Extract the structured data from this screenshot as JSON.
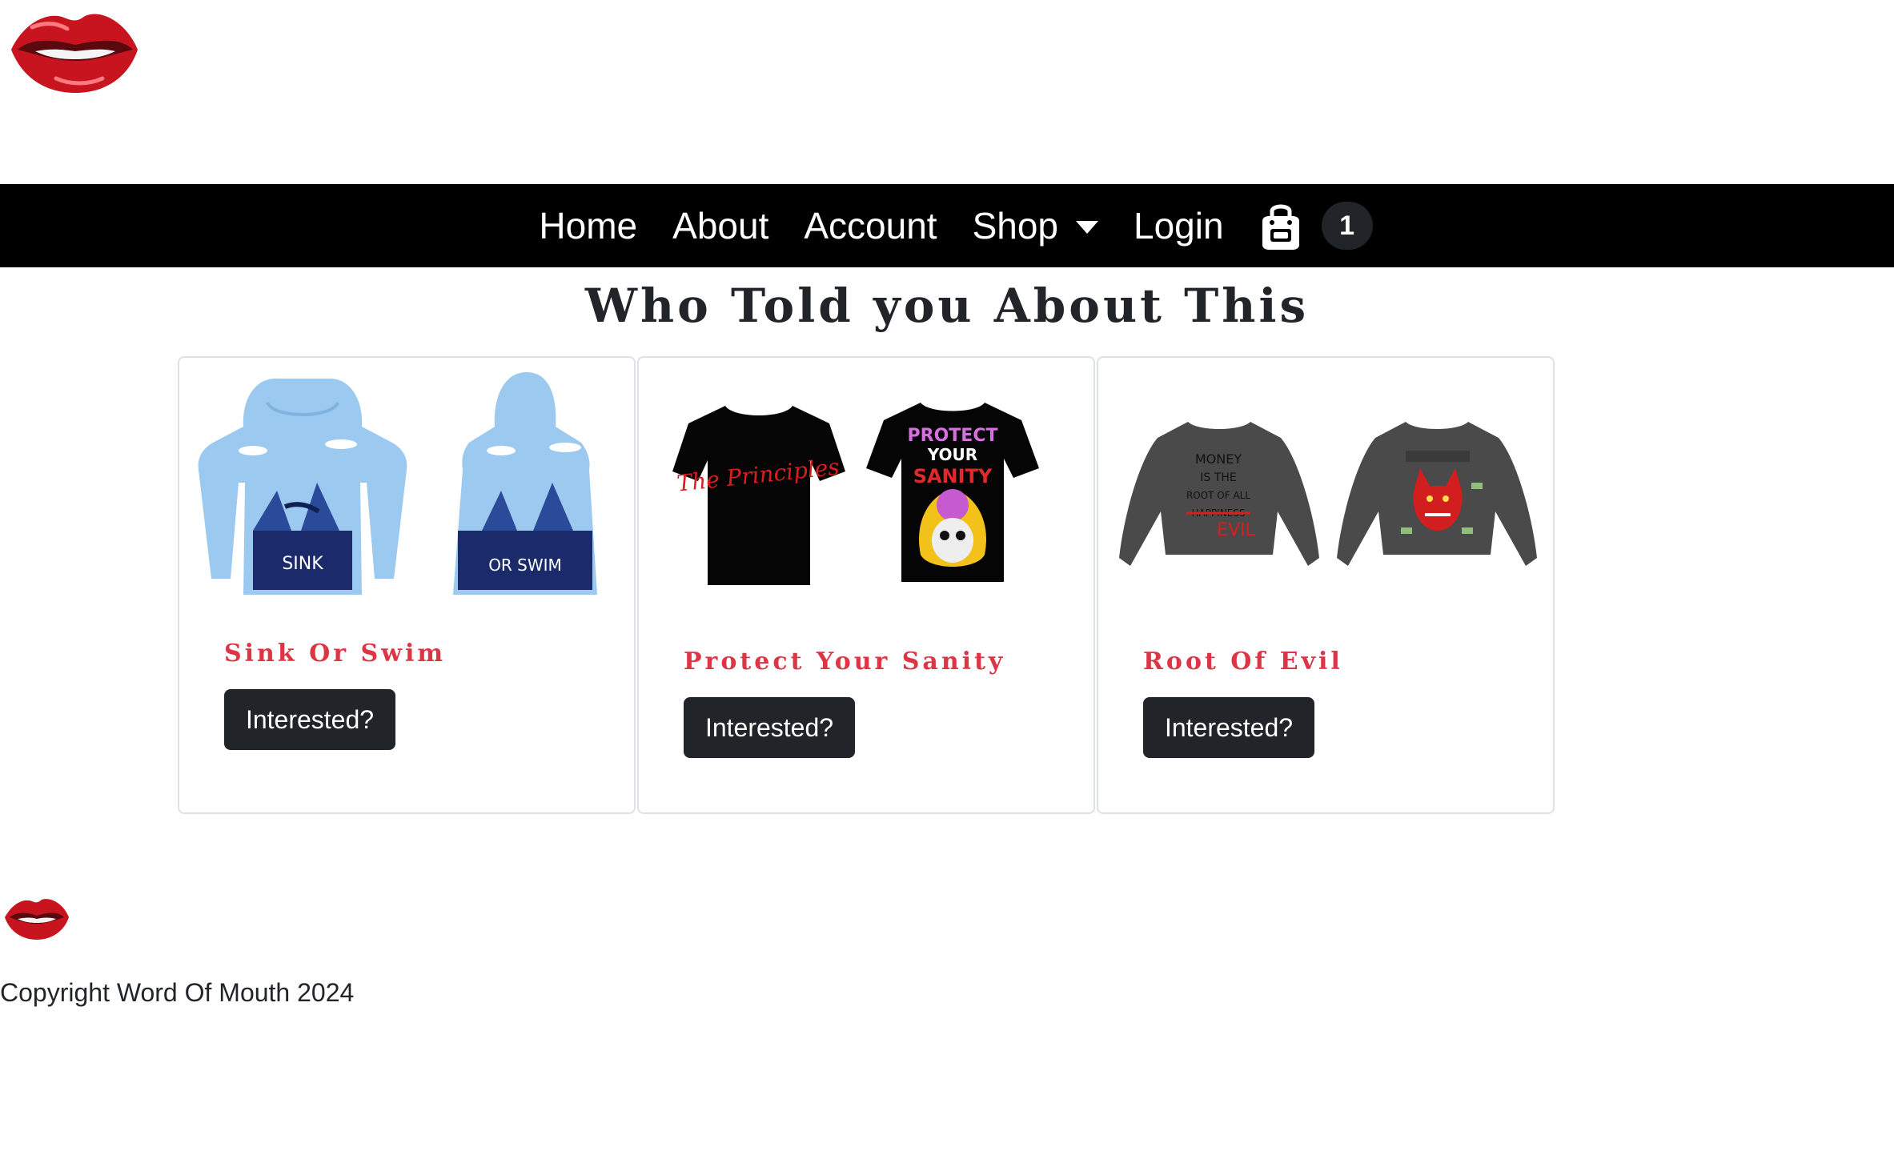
{
  "nav": {
    "items": [
      {
        "label": "Home"
      },
      {
        "label": "About"
      },
      {
        "label": "Account"
      },
      {
        "label": "Shop"
      },
      {
        "label": "Login"
      }
    ],
    "cart_count": "1"
  },
  "page": {
    "title": "Who Told you About This"
  },
  "products": [
    {
      "name": "Sink Or Swim",
      "button": "Interested?",
      "print_front": "SINK",
      "print_back": "OR SWIM"
    },
    {
      "name": "Protect Your Sanity",
      "button": "Interested?",
      "print_front": "The Principles",
      "print_back_line1": "PROTECT",
      "print_back_line2": "YOUR",
      "print_back_line3": "SANITY"
    },
    {
      "name": "Root Of Evil",
      "button": "Interested?",
      "print_front_line1": "MONEY",
      "print_front_line2": "IS THE",
      "print_front_line3": "ROOT OF ALL",
      "print_front_line4": "HAPPINESS",
      "print_front_line5": "EVIL"
    }
  ],
  "footer": {
    "copyright": "Copyright Word Of Mouth 2024"
  },
  "colors": {
    "navbar": "#000000",
    "accent_red": "#dc3545",
    "button_dark": "#212529"
  }
}
